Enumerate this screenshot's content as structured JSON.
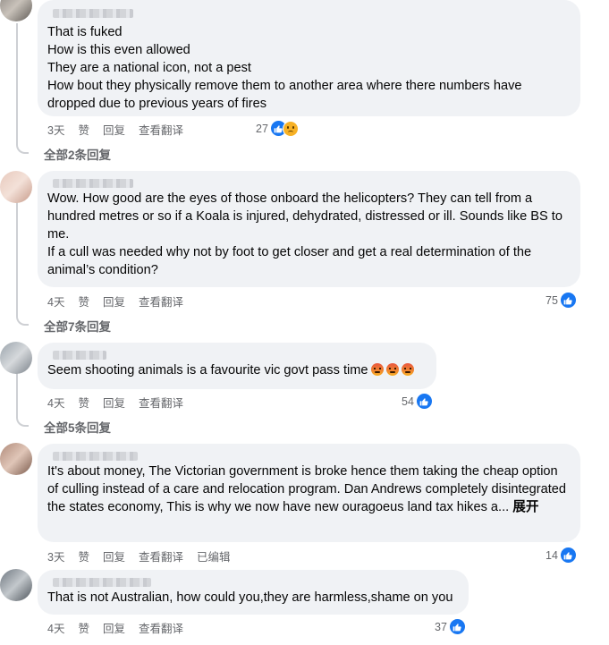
{
  "comments": [
    {
      "text": "That is fuked\nHow is this even allowed\nThey are a national icon, not a pest\nHow bout they physically remove them to another area where there numbers have dropped due to previous years of fires",
      "time": "3天",
      "like": "赞",
      "reply": "回复",
      "translate": "查看翻译",
      "reaction_count": "27",
      "reactions": [
        "like-icon",
        "sad-icon"
      ],
      "view_replies": "全部2条回复"
    },
    {
      "text": "Wow. How good are the eyes of those onboard the helicopters? They can tell from a hundred metres or so if a Koala is injured, dehydrated, distressed or ill. Sounds like BS to me.\nIf a cull was needed why not by foot to get closer and get a real determination of the animal’s condition?",
      "time": "4天",
      "like": "赞",
      "reply": "回复",
      "translate": "查看翻译",
      "reaction_count": "75",
      "reactions": [
        "like-icon"
      ],
      "view_replies": "全部7条回复"
    },
    {
      "text": "Seem shooting animals is a favourite vic govt pass time",
      "emoji": [
        "angry-face",
        "angry-face",
        "angry-face"
      ],
      "time": "4天",
      "like": "赞",
      "reply": "回复",
      "translate": "查看翻译",
      "reaction_count": "54",
      "reactions": [
        "like-icon"
      ],
      "view_replies": "全部5条回复"
    },
    {
      "text": "It's about money, The Victorian government is broke hence them taking the cheap option of culling instead of a care and relocation program. Dan Andrews completely disintegrated the states economy, This is why we now have new ouragoeus land tax hikes a...",
      "expand": "展开",
      "time": "3天",
      "like": "赞",
      "reply": "回复",
      "translate": "查看翻译",
      "edited": "已编辑",
      "reaction_count": "14",
      "reactions": [
        "like-icon"
      ]
    },
    {
      "text": "That is not Australian, how could you,they are harmless,shame on you",
      "time": "4天",
      "like": "赞",
      "reply": "回复",
      "translate": "查看翻译",
      "reaction_count": "37",
      "reactions": [
        "like-icon"
      ]
    }
  ],
  "colors": {
    "bubble": "#f0f2f5",
    "meta": "#65676b",
    "like": "#1877f2",
    "thread": "#ced0d4"
  }
}
